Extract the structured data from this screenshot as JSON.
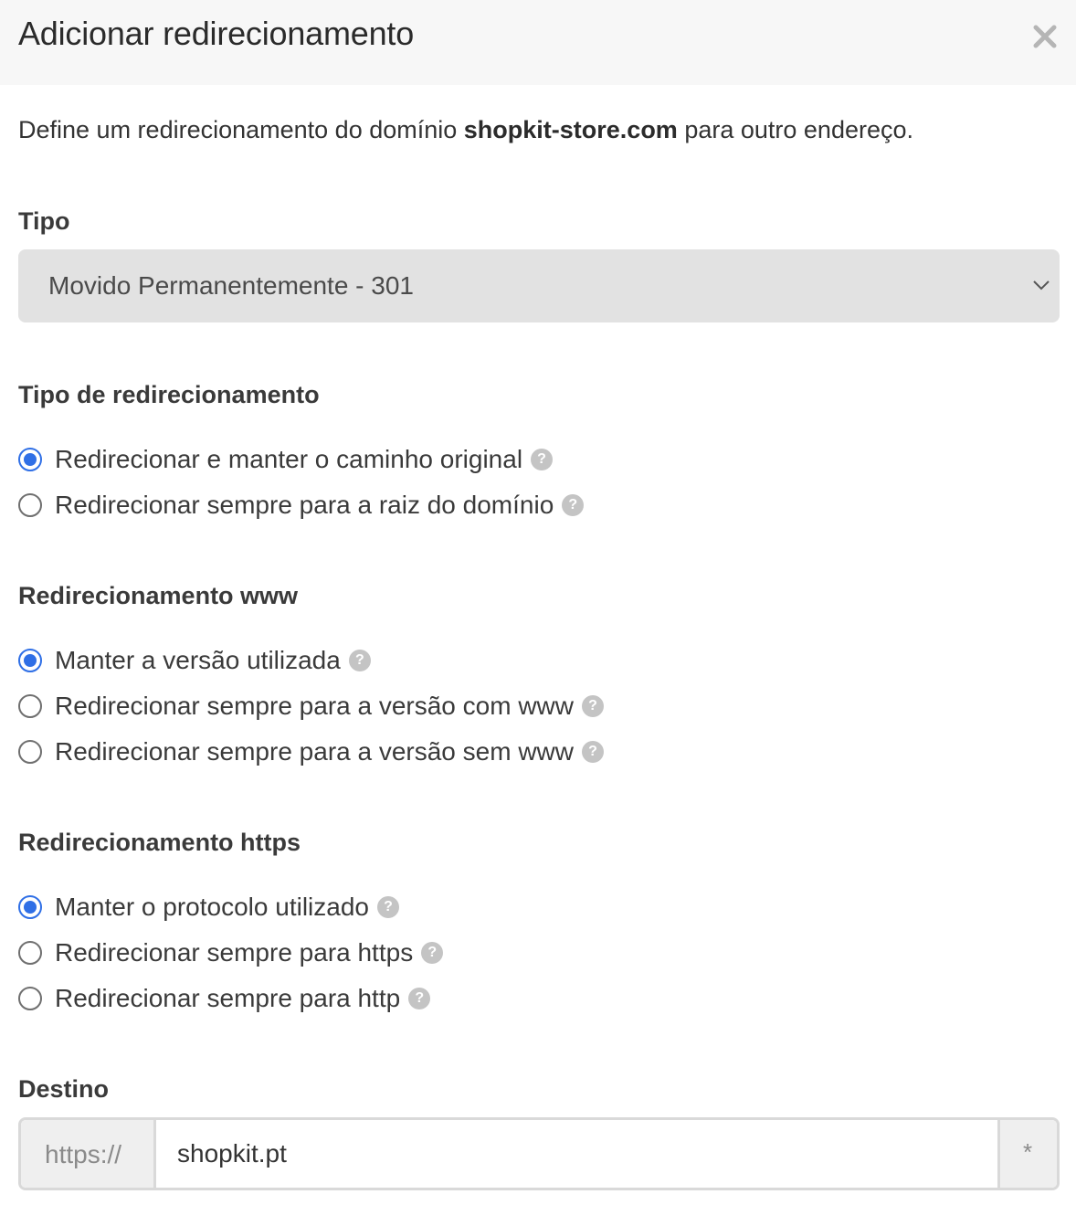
{
  "modal": {
    "title": "Adicionar redirecionamento",
    "close_icon": "close-icon"
  },
  "intro": {
    "before": "Define um redirecionamento do domínio ",
    "domain": "shopkit-store.com",
    "after": " para outro endereço."
  },
  "tipo": {
    "label": "Tipo",
    "selected": "Movido Permanentemente - 301"
  },
  "redirect_type": {
    "label": "Tipo de redirecionamento",
    "options": [
      {
        "label": "Redirecionar e manter o caminho original",
        "checked": true
      },
      {
        "label": "Redirecionar sempre para a raiz do domínio",
        "checked": false
      }
    ]
  },
  "www_redirect": {
    "label": "Redirecionamento www",
    "options": [
      {
        "label": "Manter a versão utilizada",
        "checked": true
      },
      {
        "label": "Redirecionar sempre para a versão com www",
        "checked": false
      },
      {
        "label": "Redirecionar sempre para a versão sem www",
        "checked": false
      }
    ]
  },
  "https_redirect": {
    "label": "Redirecionamento https",
    "options": [
      {
        "label": "Manter o protocolo utilizado",
        "checked": true
      },
      {
        "label": "Redirecionar sempre para https",
        "checked": false
      },
      {
        "label": "Redirecionar sempre para http",
        "checked": false
      }
    ]
  },
  "destino": {
    "label": "Destino",
    "prefix": "https://",
    "value": "shopkit.pt",
    "suffix": "*"
  },
  "help_glyph": "?",
  "colors": {
    "accent": "#2f6fe6",
    "header_bg": "#f7f7f7",
    "select_bg": "#e2e2e2",
    "help_icon": "#c4c4c4"
  }
}
